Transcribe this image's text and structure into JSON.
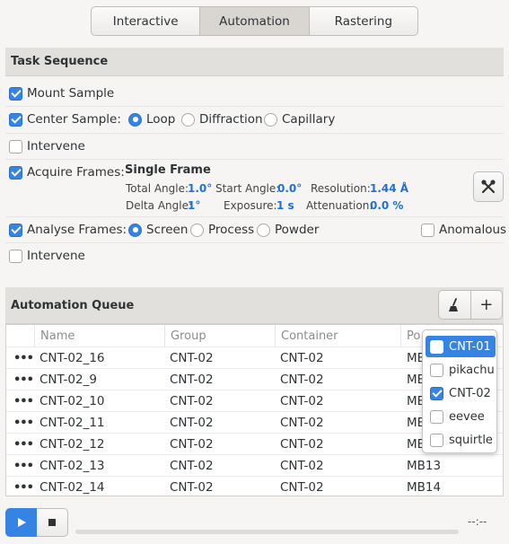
{
  "tabs": [
    {
      "label": "Interactive",
      "active": false
    },
    {
      "label": "Automation",
      "active": true
    },
    {
      "label": "Rastering",
      "active": false
    }
  ],
  "task_sequence": {
    "title": "Task Sequence",
    "mount": {
      "label": "Mount Sample",
      "checked": true
    },
    "center": {
      "label": "Center Sample:",
      "checked": true,
      "options": [
        {
          "label": "Loop",
          "selected": true
        },
        {
          "label": "Diffraction",
          "selected": false
        },
        {
          "label": "Capillary",
          "selected": false
        }
      ]
    },
    "intervene1": {
      "label": "Intervene",
      "checked": false
    },
    "acquire": {
      "label": "Acquire Frames:",
      "checked": true,
      "mode": "Single Frame",
      "params": {
        "total_angle_label": "Total Angle:",
        "total_angle": "1.0°",
        "start_angle_label": "Start Angle:",
        "start_angle": "0.0°",
        "resolution_label": "Resolution:",
        "resolution": "1.44 Å",
        "delta_angle_label": "Delta Angle:",
        "delta_angle": "1°",
        "exposure_label": "Exposure:",
        "exposure": "1 s",
        "attenuation_label": "Attenuation:",
        "attenuation": "0.0 %"
      },
      "settings_icon": "tools-icon"
    },
    "analyse": {
      "label": "Analyse Frames:",
      "checked": true,
      "options": [
        {
          "label": "Screen",
          "selected": true
        },
        {
          "label": "Process",
          "selected": false
        },
        {
          "label": "Powder",
          "selected": false
        }
      ],
      "anomalous": {
        "label": "Anomalous",
        "checked": false
      }
    },
    "intervene2": {
      "label": "Intervene",
      "checked": false
    }
  },
  "queue": {
    "title": "Automation Queue",
    "clean_icon": "broom-icon",
    "add_label": "+",
    "columns": [
      "Name",
      "Group",
      "Container",
      "Po"
    ],
    "rows": [
      {
        "menu": "•••",
        "name": "CNT-02_16",
        "group": "CNT-02",
        "container": "CNT-02",
        "port": "MB"
      },
      {
        "menu": "•••",
        "name": "CNT-02_9",
        "group": "CNT-02",
        "container": "CNT-02",
        "port": "ME"
      },
      {
        "menu": "•••",
        "name": "CNT-02_10",
        "group": "CNT-02",
        "container": "CNT-02",
        "port": "ME"
      },
      {
        "menu": "•••",
        "name": "CNT-02_11",
        "group": "CNT-02",
        "container": "CNT-02",
        "port": "ME"
      },
      {
        "menu": "•••",
        "name": "CNT-02_12",
        "group": "CNT-02",
        "container": "CNT-02",
        "port": "MB"
      },
      {
        "menu": "•••",
        "name": "CNT-02_13",
        "group": "CNT-02",
        "container": "CNT-02",
        "port": "MB13"
      },
      {
        "menu": "•••",
        "name": "CNT-02_14",
        "group": "CNT-02",
        "container": "CNT-02",
        "port": "MB14"
      }
    ],
    "group_filter": [
      {
        "label": "CNT-01",
        "checked": false,
        "highlighted": true
      },
      {
        "label": "pikachu",
        "checked": false,
        "highlighted": false
      },
      {
        "label": "CNT-02",
        "checked": true,
        "highlighted": false
      },
      {
        "label": "eevee",
        "checked": false,
        "highlighted": false
      },
      {
        "label": "squirtle",
        "checked": false,
        "highlighted": false
      }
    ]
  },
  "controls": {
    "play_icon": "play-icon",
    "stop_icon": "stop-icon",
    "progress": 0,
    "eta": "--:--"
  }
}
